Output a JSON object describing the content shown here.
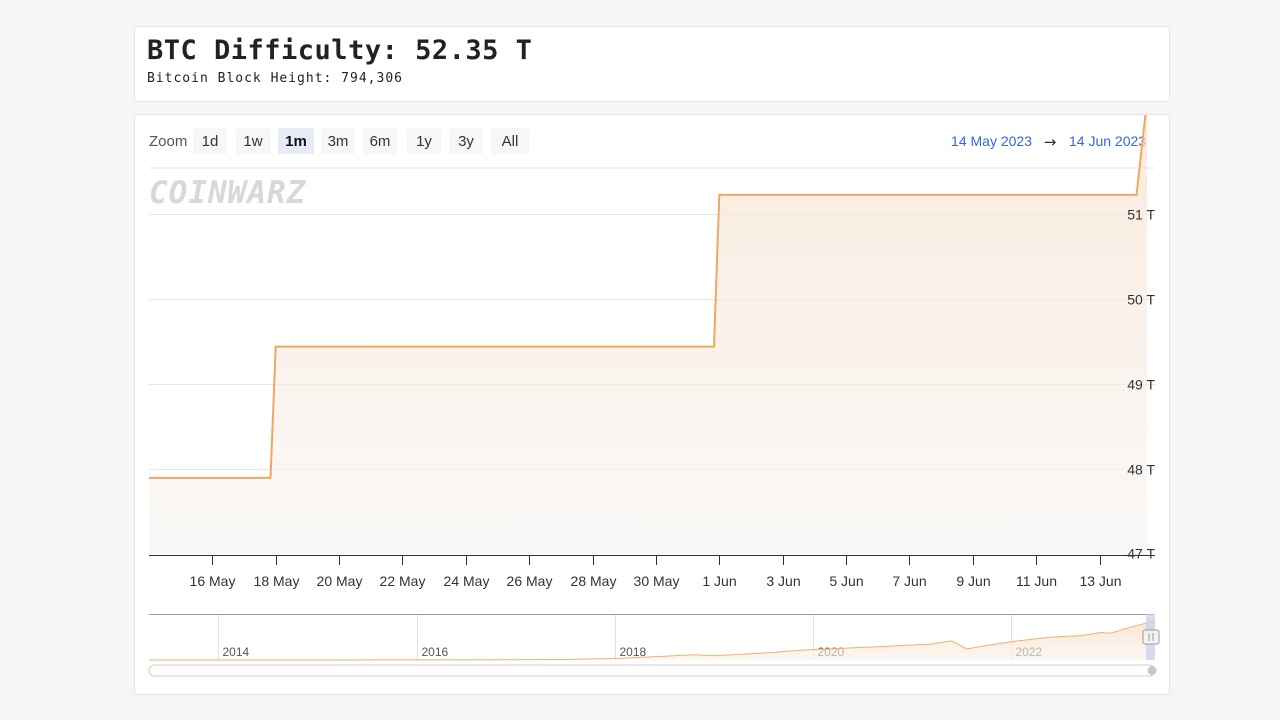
{
  "header": {
    "title": "BTC Difficulty: 52.35 T",
    "subtitle": "Bitcoin Block Height: 794,306"
  },
  "toolbar": {
    "zoom_label": "Zoom",
    "zoom_buttons": [
      "1d",
      "1w",
      "1m",
      "3m",
      "6m",
      "1y",
      "3y",
      "All"
    ],
    "active_zoom": "1m",
    "range_from": "14 May 2023",
    "range_arrow": "→",
    "range_to": "14 Jun 2023"
  },
  "watermark": "COINWARZ",
  "colors": {
    "series": "#f0a860",
    "accent_blue": "#3366dd",
    "active_button_bg": "#e6ebf5"
  },
  "chart_data": {
    "type": "area",
    "x_domain": [
      "2023-05-14",
      "2023-06-14"
    ],
    "ylim": [
      47,
      51.5
    ],
    "y_ticks": [
      "47 T",
      "48 T",
      "49 T",
      "50 T",
      "51 T"
    ],
    "y_tick_values": [
      47,
      48,
      49,
      50,
      51
    ],
    "x_tick_labels": [
      "16 May",
      "18 May",
      "20 May",
      "22 May",
      "24 May",
      "26 May",
      "28 May",
      "30 May",
      "1 Jun",
      "3 Jun",
      "5 Jun",
      "7 Jun",
      "9 Jun",
      "11 Jun",
      "13 Jun"
    ],
    "series": [
      {
        "points": [
          [
            "2023-05-14",
            47.89
          ],
          [
            "2023-05-17 20:00",
            47.89
          ],
          [
            "2023-05-18 00:00",
            49.44
          ],
          [
            "2023-05-31 20:00",
            49.44
          ],
          [
            "2023-06-01 00:00",
            51.23
          ],
          [
            "2023-06-14 04:00",
            51.23
          ],
          [
            "2023-06-14 12:00",
            52.35
          ]
        ]
      }
    ],
    "grid": true,
    "navigator": {
      "x_tick_labels": [
        "2014",
        "2016",
        "2018",
        "2020",
        "2022"
      ],
      "x_tick_years": [
        2014,
        2016,
        2018,
        2020,
        2022
      ],
      "year_range": [
        2013.3,
        2023.45
      ],
      "values_t": [
        [
          2013.3,
          0.0
        ],
        [
          2014.0,
          0.0
        ],
        [
          2015.0,
          0.05
        ],
        [
          2016.0,
          0.1
        ],
        [
          2017.0,
          0.3
        ],
        [
          2017.5,
          0.7
        ],
        [
          2018.0,
          2.0
        ],
        [
          2018.5,
          5.0
        ],
        [
          2018.8,
          7.0
        ],
        [
          2019.0,
          5.6
        ],
        [
          2019.5,
          9.0
        ],
        [
          2019.9,
          13.0
        ],
        [
          2020.3,
          15.5
        ],
        [
          2020.6,
          17.0
        ],
        [
          2020.9,
          19.0
        ],
        [
          2021.2,
          21.0
        ],
        [
          2021.4,
          25.0
        ],
        [
          2021.55,
          14.4
        ],
        [
          2021.75,
          19.0
        ],
        [
          2022.0,
          24.0
        ],
        [
          2022.4,
          30.0
        ],
        [
          2022.7,
          32.0
        ],
        [
          2022.9,
          36.0
        ],
        [
          2023.0,
          35.0
        ],
        [
          2023.2,
          43.0
        ],
        [
          2023.35,
          48.0
        ],
        [
          2023.45,
          52.35
        ]
      ],
      "ylim": [
        0,
        55
      ]
    }
  }
}
